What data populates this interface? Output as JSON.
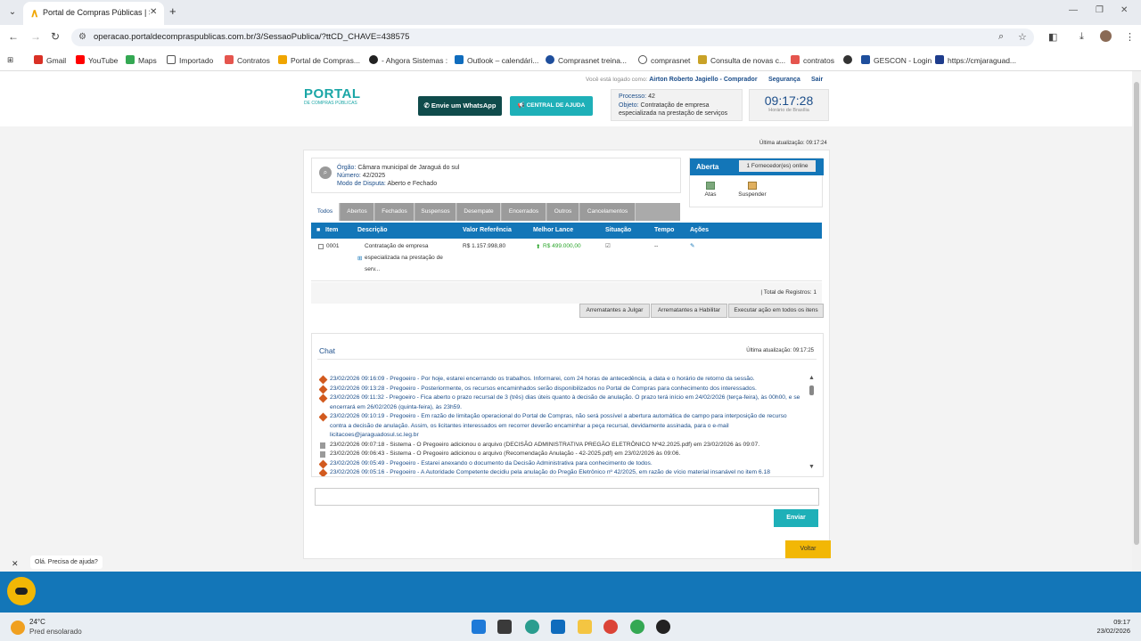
{
  "browser": {
    "tab_title": "Portal de Compras Públicas | Se",
    "url": "operacao.portaldecompraspublicas.com.br/3/SessaoPublica/?ttCD_CHAVE=438575",
    "bookmarks": [
      "Gmail",
      "YouTube",
      "Maps",
      "Importado",
      "Contratos",
      "Portal de Compras...",
      "- Ahgora Sistemas :",
      "Outlook – calendári...",
      "Comprasnet treina...",
      "comprasnet",
      "Consulta de novas c...",
      "contratos",
      "GESCON - Login",
      "https://cmjaraguad..."
    ]
  },
  "header": {
    "logo": "PORTAL",
    "logo_sub": "DE COMPRAS PÚBLICAS",
    "user_prefix": "Você está logado como:",
    "user": "Airton Roberto Jagiello - Comprador",
    "seguranca": "Segurança",
    "sair": "Sair",
    "whatsapp": "Envie um WhatsApp",
    "ajuda": "CENTRAL DE AJUDA",
    "processo_label": "Processo:",
    "processo": "42",
    "objeto_label": "Objeto:",
    "objeto": "Contratação de empresa especializada na prestação de serviços",
    "clock": "09:17:28",
    "clock_sub": "Horário de Brasília"
  },
  "ultima_atualizacao": "Última atualização: 09:17:24",
  "orgao": {
    "orgao_label": "Órgão:",
    "orgao": "Câmara municipal de Jaraguá do sul",
    "numero_label": "Número:",
    "numero": "42/2025",
    "modo_label": "Modo de Disputa:",
    "modo": "Aberto e Fechado"
  },
  "status": {
    "label": "Aberta",
    "fornecedores": "1 Fornecedor(es) online",
    "atas": "Atas",
    "suspender": "Suspender"
  },
  "tabs": [
    "Todos",
    "Abertos",
    "Fechados",
    "Suspensos",
    "Desempate",
    "Encerrados",
    "Outros",
    "Cancelamentos"
  ],
  "table": {
    "headers": [
      "Item",
      "Descrição",
      "Valor Referência",
      "Melhor Lance",
      "Situação",
      "Tempo",
      "Ações"
    ],
    "row": {
      "item": "0001",
      "desc1": "Contratação de empresa",
      "desc2": "especializada na prestação de",
      "desc3": "serv...",
      "valor": "R$ 1.157.998,80",
      "lance": "R$ 499.000,00",
      "tempo": "--"
    },
    "total": "| Total de Registros: 1"
  },
  "buttons": {
    "julgar": "Arrematantes a Julgar",
    "habilitar": "Arrematantes a Habilitar",
    "executar": "Executar ação em todos os itens"
  },
  "chat": {
    "title": "Chat",
    "ultima": "Última atualização: 09:17:25",
    "messages": [
      {
        "type": "p",
        "text": "23/02/2026 09:16:09 - Pregoeiro - Por hoje, estarei encerrando os trabalhos. Informarei, com 24 horas de antecedência, a data e o horário de retorno da sessão."
      },
      {
        "type": "p",
        "text": "23/02/2026 09:13:28 - Pregoeiro - Posteriormente, os recursos encaminhados serão disponibilizados no Portal de Compras para conhecimento dos interessados."
      },
      {
        "type": "p",
        "text": "23/02/2026 09:11:32 - Pregoeiro - Fica aberto o prazo recursal de 3 (três) dias úteis quanto à decisão de anulação. O prazo terá início em 24/02/2026 (terça-feira), às 00h00, e se encerrará em 26/02/2026 (quinta-feira), às 23h59."
      },
      {
        "type": "p",
        "text": "23/02/2026 09:10:19 - Pregoeiro - Em razão de limitação operacional do Portal de Compras, não será possível a abertura automática de campo para interposição de recurso contra a decisão de anulação. Assim, os licitantes interessados em recorrer deverão encaminhar a peça recursal, devidamente assinada, para o e-mail licitacoes@jaraguadosul.sc.leg.br"
      },
      {
        "type": "s",
        "text": "23/02/2026 09:07:18 - Sistema - O Pregoeiro adicionou o arquivo (DECISÃO ADMINISTRATIVA PREGÃO ELETRÔNICO Nº42.2025.pdf) em 23/02/2026 às 09:07."
      },
      {
        "type": "s",
        "text": "23/02/2026 09:06:43 - Sistema - O Pregoeiro adicionou o arquivo (Recomendação Anulação - 42-2025.pdf) em 23/02/2026 às 09:06."
      },
      {
        "type": "p",
        "text": "23/02/2026 09:05:49 - Pregoeiro - Estarei anexando o documento da Decisão Administrativa para conhecimento de todos."
      },
      {
        "type": "p",
        "text": "23/02/2026 09:05:16 - Pregoeiro - A Autoridade Competente decidiu pela anulação do Pregão Eletrônico nº 42/2025, em razão de vício material insanável no item 6.18"
      }
    ],
    "enviar": "Enviar",
    "voltar": "Voltar"
  },
  "help": "Olá. Precisa de ajuda?",
  "taskbar": {
    "temp": "24°C",
    "weather": "Pred ensolarado",
    "time": "09:17",
    "date": "23/02/2026"
  }
}
